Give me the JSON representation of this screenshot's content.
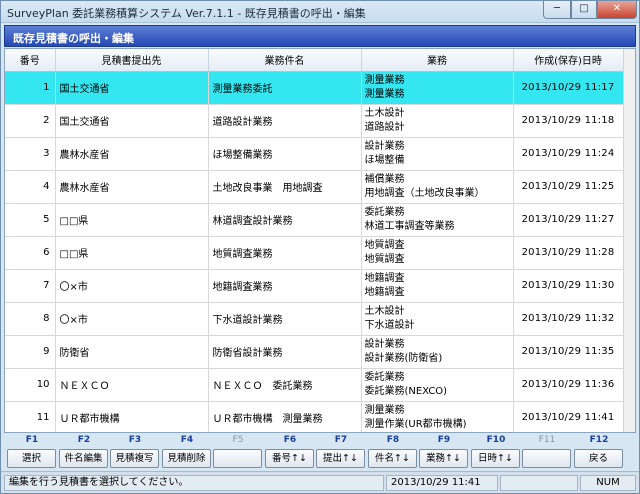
{
  "window": {
    "title": "SurveyPlan 委託業務積算システム Ver.7.1.1 - 既存見積書の呼出・編集",
    "minimize": "─",
    "maximize": "□",
    "close": "✕"
  },
  "header": {
    "title": "既存見積書の呼出・編集"
  },
  "table": {
    "columns": [
      "番号",
      "見積書提出先",
      "業務件名",
      "業務",
      "作成(保存)日時"
    ],
    "rows": [
      {
        "no": "1",
        "client": "国土交通省",
        "name": "測量業務委託",
        "work1": "測量業務",
        "work2": "測量業務",
        "date": "2013/10/29  11:17"
      },
      {
        "no": "2",
        "client": "国土交通省",
        "name": "道路設計業務",
        "work1": "土木設計",
        "work2": "道路設計",
        "date": "2013/10/29  11:18"
      },
      {
        "no": "3",
        "client": "農林水産省",
        "name": "ほ場整備業務",
        "work1": "設計業務",
        "work2": "ほ場整備",
        "date": "2013/10/29  11:24"
      },
      {
        "no": "4",
        "client": "農林水産省",
        "name": "土地改良事業　用地調査",
        "work1": "補償業務",
        "work2": "用地調査（土地改良事業）",
        "date": "2013/10/29  11:25"
      },
      {
        "no": "5",
        "client": "□□県",
        "name": "林道調査設計業務",
        "work1": "委託業務",
        "work2": "林道工事調査等業務",
        "date": "2013/10/29  11:27"
      },
      {
        "no": "6",
        "client": "□□県",
        "name": "地質調査業務",
        "work1": "地質調査",
        "work2": "地質調査",
        "date": "2013/10/29  11:28"
      },
      {
        "no": "7",
        "client": "〇×市",
        "name": "地籍調査業務",
        "work1": "地籍調査",
        "work2": "地籍調査",
        "date": "2013/10/29  11:30"
      },
      {
        "no": "8",
        "client": "〇×市",
        "name": "下水道設計業務",
        "work1": "土木設計",
        "work2": "下水道設計",
        "date": "2013/10/29  11:32"
      },
      {
        "no": "9",
        "client": "防衛省",
        "name": "防衛省設計業務",
        "work1": "設計業務",
        "work2": "設計業務(防衛省)",
        "date": "2013/10/29  11:35"
      },
      {
        "no": "10",
        "client": "ＮＥＸＣＯ",
        "name": "ＮＥＸＣＯ　委託業務",
        "work1": "委託業務",
        "work2": "委託業務(NEXCO)",
        "date": "2013/10/29  11:36"
      },
      {
        "no": "11",
        "client": "ＵＲ都市機構",
        "name": "ＵＲ都市機構　測量業務",
        "work1": "測量業務",
        "work2": "測量作業(UR都市機構)",
        "date": "2013/10/29  11:41"
      }
    ]
  },
  "fkeys": [
    {
      "key": "F1",
      "label": "選択",
      "enabled": true
    },
    {
      "key": "F2",
      "label": "件名編集",
      "enabled": true
    },
    {
      "key": "F3",
      "label": "見積複写",
      "enabled": true
    },
    {
      "key": "F4",
      "label": "見積削除",
      "enabled": true
    },
    {
      "key": "F5",
      "label": "",
      "enabled": false
    },
    {
      "key": "F6",
      "label": "番号↑↓",
      "enabled": true
    },
    {
      "key": "F7",
      "label": "提出↑↓",
      "enabled": true
    },
    {
      "key": "F8",
      "label": "件名↑↓",
      "enabled": true
    },
    {
      "key": "F9",
      "label": "業務↑↓",
      "enabled": true
    },
    {
      "key": "F10",
      "label": "日時↑↓",
      "enabled": true
    },
    {
      "key": "F11",
      "label": "",
      "enabled": false
    },
    {
      "key": "F12",
      "label": "戻る",
      "enabled": true
    }
  ],
  "status": {
    "message": "編集を行う見積書を選択してください。",
    "datetime": "2013/10/29  11:41",
    "num": "NUM"
  },
  "colors": {
    "selected_row": "#33e6f0",
    "header_band": "#2448b5",
    "fkey_label": "#1a3f9a"
  },
  "selected_row": 0
}
